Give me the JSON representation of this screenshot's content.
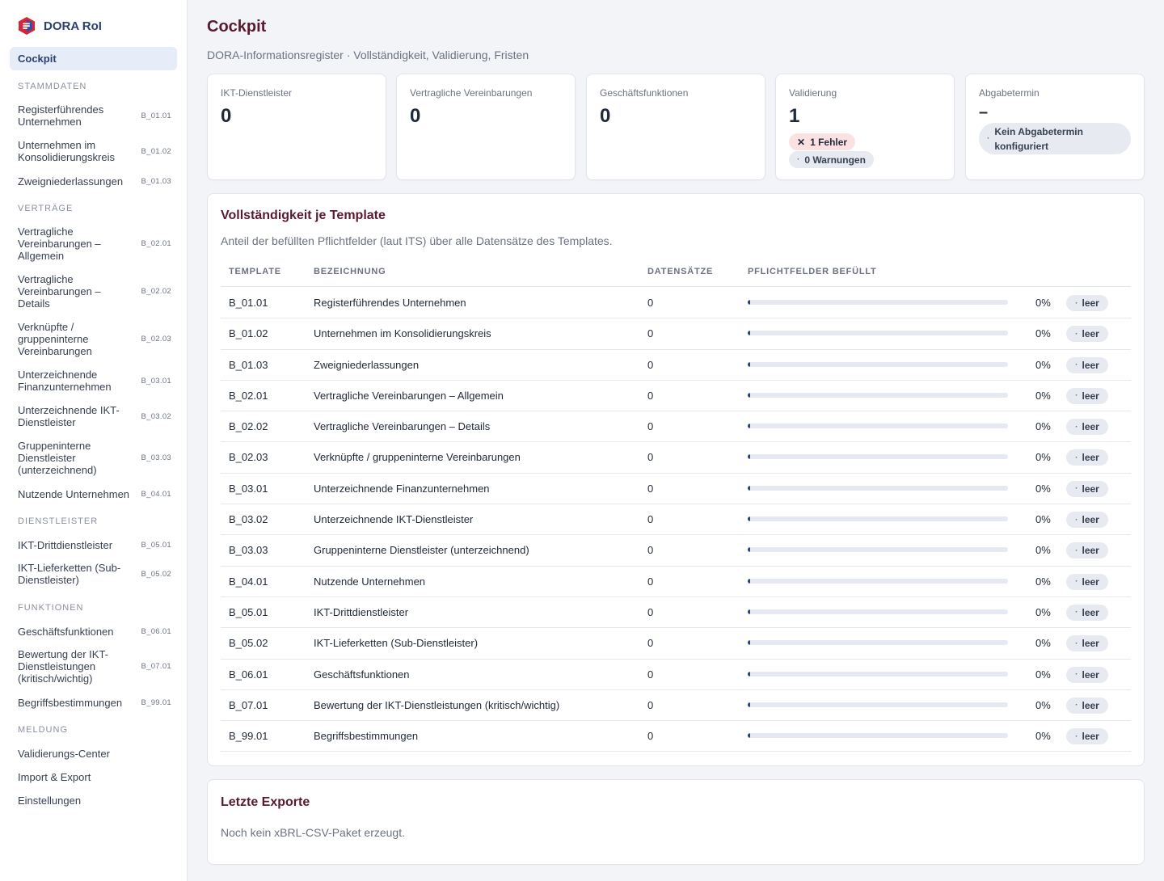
{
  "app": {
    "name": "DORA RoI"
  },
  "sidebar": {
    "active": "Cockpit",
    "sections": [
      {
        "title": "Stammdaten",
        "items": [
          {
            "label": "Registerführendes Unternehmen",
            "code": "B_01.01"
          },
          {
            "label": "Unternehmen im Konsolidierungskreis",
            "code": "B_01.02"
          },
          {
            "label": "Zweigniederlassungen",
            "code": "B_01.03"
          }
        ]
      },
      {
        "title": "Verträge",
        "items": [
          {
            "label": "Vertragliche Vereinbarungen – Allgemein",
            "code": "B_02.01"
          },
          {
            "label": "Vertragliche Vereinbarungen – Details",
            "code": "B_02.02"
          },
          {
            "label": "Verknüpfte / gruppeninterne Vereinbarungen",
            "code": "B_02.03"
          },
          {
            "label": "Unterzeichnende Finanzunternehmen",
            "code": "B_03.01"
          },
          {
            "label": "Unterzeichnende IKT-Dienstleister",
            "code": "B_03.02"
          },
          {
            "label": "Gruppeninterne Dienstleister (unterzeichnend)",
            "code": "B_03.03"
          },
          {
            "label": "Nutzende Unternehmen",
            "code": "B_04.01"
          }
        ]
      },
      {
        "title": "Dienstleister",
        "items": [
          {
            "label": "IKT-Drittdienstleister",
            "code": "B_05.01"
          },
          {
            "label": "IKT-Lieferketten (Sub-Dienstleister)",
            "code": "B_05.02"
          }
        ]
      },
      {
        "title": "Funktionen",
        "items": [
          {
            "label": "Geschäftsfunktionen",
            "code": "B_06.01"
          },
          {
            "label": "Bewertung der IKT-Dienstleistungen (kritisch/wichtig)",
            "code": "B_07.01"
          },
          {
            "label": "Begriffsbestimmungen",
            "code": "B_99.01"
          }
        ]
      },
      {
        "title": "Meldung",
        "items": [
          {
            "label": "Validierungs-Center",
            "code": ""
          },
          {
            "label": "Import & Export",
            "code": ""
          },
          {
            "label": "Einstellungen",
            "code": ""
          }
        ]
      }
    ]
  },
  "header": {
    "title": "Cockpit",
    "subtitle": "DORA-Informationsregister · Vollständigkeit, Validierung, Fristen"
  },
  "stats": {
    "ikt": {
      "label": "IKT-Dienstleister",
      "value": "0"
    },
    "vertraege": {
      "label": "Vertragliche Vereinbarungen",
      "value": "0"
    },
    "funktionen": {
      "label": "Geschäftsfunktionen",
      "value": "0"
    },
    "validierung": {
      "label": "Validierung",
      "value": "1",
      "errors": "1 Fehler",
      "warnings": "0 Warnungen"
    },
    "abgabe": {
      "label": "Abgabetermin",
      "value": "–",
      "note": "Kein Abgabetermin konfiguriert"
    }
  },
  "completeness": {
    "title": "Vollständigkeit je Template",
    "description": "Anteil der befüllten Pflichtfelder (laut ITS) über alle Datensätze des Templates.",
    "columns": {
      "template": "Template",
      "name": "Bezeichnung",
      "records": "Datensätze",
      "filled": "Pflichtfelder befüllt"
    },
    "rows": [
      {
        "template": "B_01.01",
        "name": "Registerführendes Unternehmen",
        "records": "0",
        "percent": "0%",
        "fill": 0,
        "status": "leer"
      },
      {
        "template": "B_01.02",
        "name": "Unternehmen im Konsolidierungskreis",
        "records": "0",
        "percent": "0%",
        "fill": 0,
        "status": "leer"
      },
      {
        "template": "B_01.03",
        "name": "Zweigniederlassungen",
        "records": "0",
        "percent": "0%",
        "fill": 0,
        "status": "leer"
      },
      {
        "template": "B_02.01",
        "name": "Vertragliche Vereinbarungen – Allgemein",
        "records": "0",
        "percent": "0%",
        "fill": 0,
        "status": "leer"
      },
      {
        "template": "B_02.02",
        "name": "Vertragliche Vereinbarungen – Details",
        "records": "0",
        "percent": "0%",
        "fill": 0,
        "status": "leer"
      },
      {
        "template": "B_02.03",
        "name": "Verknüpfte / gruppeninterne Vereinbarungen",
        "records": "0",
        "percent": "0%",
        "fill": 0,
        "status": "leer"
      },
      {
        "template": "B_03.01",
        "name": "Unterzeichnende Finanzunternehmen",
        "records": "0",
        "percent": "0%",
        "fill": 0,
        "status": "leer"
      },
      {
        "template": "B_03.02",
        "name": "Unterzeichnende IKT-Dienstleister",
        "records": "0",
        "percent": "0%",
        "fill": 0,
        "status": "leer"
      },
      {
        "template": "B_03.03",
        "name": "Gruppeninterne Dienstleister (unterzeichnend)",
        "records": "0",
        "percent": "0%",
        "fill": 0,
        "status": "leer"
      },
      {
        "template": "B_04.01",
        "name": "Nutzende Unternehmen",
        "records": "0",
        "percent": "0%",
        "fill": 0,
        "status": "leer"
      },
      {
        "template": "B_05.01",
        "name": "IKT-Drittdienstleister",
        "records": "0",
        "percent": "0%",
        "fill": 0,
        "status": "leer"
      },
      {
        "template": "B_05.02",
        "name": "IKT-Lieferketten (Sub-Dienstleister)",
        "records": "0",
        "percent": "0%",
        "fill": 0,
        "status": "leer"
      },
      {
        "template": "B_06.01",
        "name": "Geschäftsfunktionen",
        "records": "0",
        "percent": "0%",
        "fill": 0,
        "status": "leer"
      },
      {
        "template": "B_07.01",
        "name": "Bewertung der IKT-Dienstleistungen (kritisch/wichtig)",
        "records": "0",
        "percent": "0%",
        "fill": 0,
        "status": "leer"
      },
      {
        "template": "B_99.01",
        "name": "Begriffsbestimmungen",
        "records": "0",
        "percent": "0%",
        "fill": 0,
        "status": "leer"
      }
    ]
  },
  "exports": {
    "title": "Letzte Exporte",
    "empty": "Noch kein xBRL-CSV-Paket erzeugt."
  },
  "colors": {
    "brand": "#2b3f73",
    "title": "#5a1a2e",
    "logo_red": "#d6263a"
  }
}
